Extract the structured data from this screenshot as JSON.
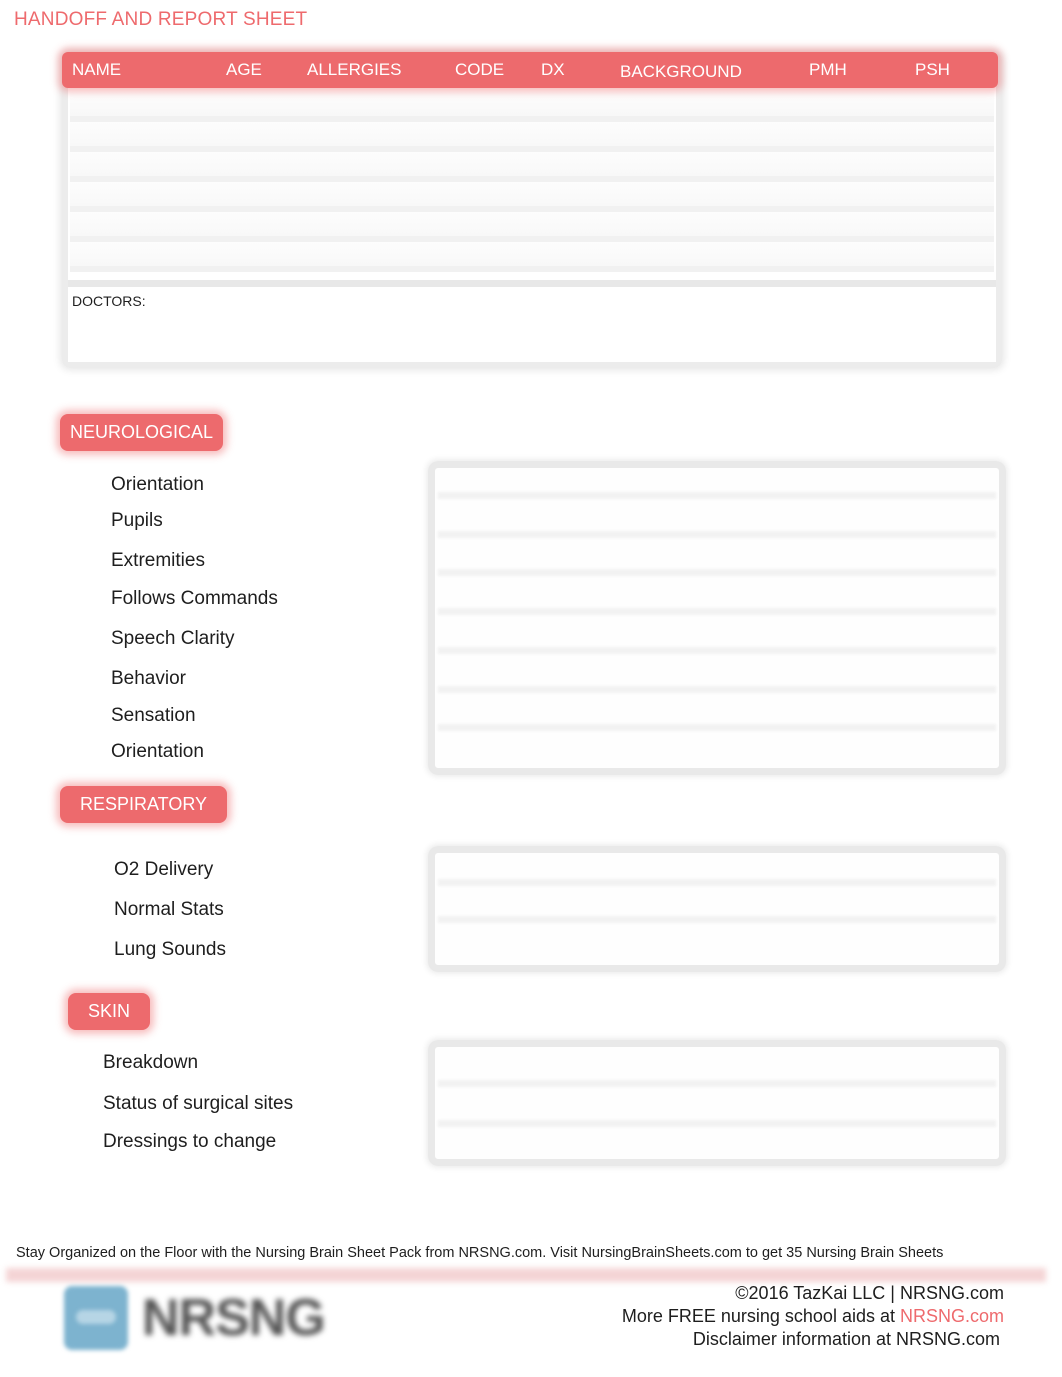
{
  "title": "HANDOFF AND REPORT SHEET",
  "patient_table": {
    "columns": [
      "NAME",
      "AGE",
      "ALLERGIES",
      "CODE",
      "DX",
      "BACKGROUND",
      "PMH",
      "PSH"
    ],
    "rows": 6,
    "doctors_label": "DOCTORS:"
  },
  "sections": {
    "neurological": {
      "label": "NEUROLOGICAL",
      "items": [
        "Orientation",
        "Pupils",
        "Extremities",
        "Follows Commands",
        "Speech Clarity",
        "Behavior",
        "Sensation",
        "Orientation"
      ]
    },
    "respiratory": {
      "label": "RESPIRATORY",
      "items": [
        "O2 Delivery",
        "Normal Stats",
        "Lung Sounds"
      ]
    },
    "skin": {
      "label": "SKIN",
      "items": [
        "Breakdown",
        "Status of surgical sites",
        "Dressings to change"
      ]
    }
  },
  "footer": {
    "promo": "Stay Organized on the Floor with the Nursing Brain Sheet Pack from NRSNG.com.  Visit NursingBrainSheets.com to get 35 Nursing Brain Sheets",
    "logo_text": "NRSNG",
    "copyright": "©2016 TazKai LLC | NRSNG.com",
    "more_prefix": "More FREE nursing school aids at ",
    "more_link": "NRSNG.com",
    "disclaimer": "Disclaimer information at NRSNG.com"
  },
  "colors": {
    "accent": "#ed6a6d",
    "logo_blue": "#7db3cf",
    "text": "#1e1e1e"
  }
}
